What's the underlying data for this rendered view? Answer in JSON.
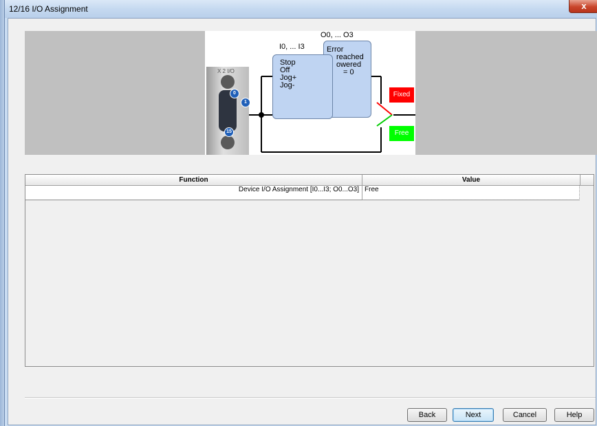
{
  "window": {
    "title": "12/16 I/O Assignment",
    "close_label": "x"
  },
  "diagram": {
    "connector_label": "X 2 I/O",
    "pins": [
      "0",
      "1",
      "15"
    ],
    "inputs_label": "I0, ... I3",
    "outputs_label": "O0, ... O3",
    "input_functions": [
      "Stop",
      "Off",
      "Jog+",
      "Jog-"
    ],
    "output_functions": [
      "Error",
      "reached",
      "owered",
      "= 0"
    ],
    "fixed_label": "Fixed",
    "free_label": "Free",
    "colors": {
      "fixed": "#ff0000",
      "free": "#00ff00",
      "box": "#bfd4f2"
    }
  },
  "table": {
    "columns": [
      "Function",
      "Value"
    ],
    "rows": [
      {
        "function": "Device I/O Assignment [I0...I3; O0...O3]",
        "value": "Free"
      }
    ]
  },
  "buttons": {
    "back": "Back",
    "next": "Next",
    "cancel": "Cancel",
    "help": "Help"
  }
}
